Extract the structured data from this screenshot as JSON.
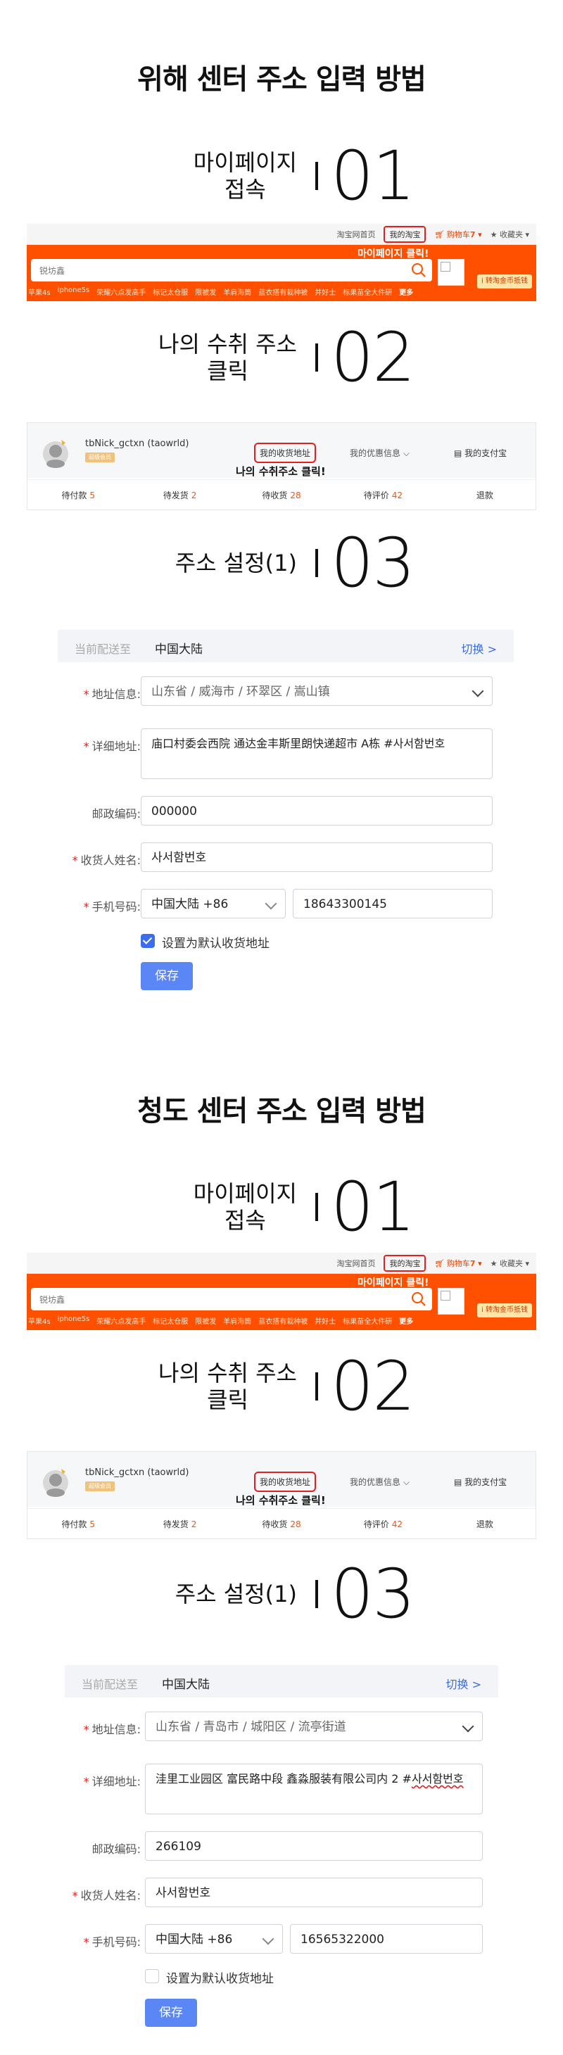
{
  "sections": [
    {
      "title": "위해 센터 주소 입력 방법",
      "steps": [
        {
          "label_lines": [
            "마이페이지",
            "접속"
          ],
          "number": "01"
        },
        {
          "label_lines": [
            "나의 수취 주소",
            "클릭"
          ],
          "number": "02"
        },
        {
          "label_lines": [
            "주소 설정(1)"
          ],
          "number": "03"
        }
      ],
      "taobao_header": {
        "top_links": [
          "淘宝网首页",
          "我的淘宝",
          "购物车",
          "7",
          "收藏夹"
        ],
        "annotation": "마이페이지 클릭!",
        "search_placeholder": "锐坊鑫",
        "badge": "i 转淘金币抵钱",
        "categories": [
          "苹果4s",
          "iphone5s",
          "荣耀六点发高手",
          "标记太仓服",
          "限被发",
          "羊肩海筒",
          "蓝衣搭有栽种被",
          "并好士",
          "标果苗全大件研",
          "更多"
        ]
      },
      "my_taobao": {
        "username": "tbNick_gctxn (taowrld)",
        "tag": "超级会员",
        "address_link": "我的收货地址",
        "annotation": "나의 수취주소 클릭!",
        "coupon": "我的优惠信息",
        "pay": "我的支付宝",
        "tabs": [
          {
            "label": "待付款",
            "count": "5"
          },
          {
            "label": "待发货",
            "count": "2"
          },
          {
            "label": "待收货",
            "count": "28"
          },
          {
            "label": "待评价",
            "count": "42"
          },
          {
            "label": "退款",
            "count": ""
          }
        ]
      },
      "form": {
        "deliver_label": "当前配送至",
        "deliver_value": "中国大陆",
        "switch": "切换 >",
        "address_label": "地址信息:",
        "address_value": "山东省 / 威海市 / 环翠区 / 嵩山镇",
        "detail_label": "详细地址:",
        "detail_value": "庙口村委会西院 通达金丰斯里朗快递超市 A栋 #사서함번호",
        "zip_label": "邮政编码:",
        "zip_value": "000000",
        "name_label": "收货人姓名:",
        "name_value": "사서함번호",
        "phone_label": "手机号码:",
        "phone_region": "中国大陆 +86",
        "phone_value": "18643300145",
        "default_label": "设置为默认收货地址",
        "default_checked": true,
        "save": "保存"
      }
    },
    {
      "title": "청도 센터 주소 입력 방법",
      "steps": [
        {
          "label_lines": [
            "마이페이지",
            "접속"
          ],
          "number": "01"
        },
        {
          "label_lines": [
            "나의 수취 주소",
            "클릭"
          ],
          "number": "02"
        },
        {
          "label_lines": [
            "주소 설정(1)"
          ],
          "number": "03"
        }
      ],
      "taobao_header": {
        "top_links": [
          "淘宝网首页",
          "我的淘宝",
          "购物车",
          "7",
          "收藏夹"
        ],
        "annotation": "마이페이지 클릭!",
        "search_placeholder": "锐坊鑫",
        "badge": "i 转淘金币抵钱",
        "categories": [
          "苹果4s",
          "iphone5s",
          "荣耀六点发高手",
          "标记太仓服",
          "限被发",
          "羊肩海筒",
          "蓝衣搭有栽种被",
          "并好士",
          "标果苗全大件研",
          "更多"
        ]
      },
      "my_taobao": {
        "username": "tbNick_gctxn (taowrld)",
        "tag": "超级会员",
        "address_link": "我的收货地址",
        "annotation": "나의 수취주소 클릭!",
        "coupon": "我的优惠信息",
        "pay": "我的支付宝",
        "tabs": [
          {
            "label": "待付款",
            "count": "5"
          },
          {
            "label": "待发货",
            "count": "2"
          },
          {
            "label": "待收货",
            "count": "28"
          },
          {
            "label": "待评价",
            "count": "42"
          },
          {
            "label": "退款",
            "count": ""
          }
        ]
      },
      "form": {
        "deliver_label": "当前配送至",
        "deliver_value": "中国大陆",
        "switch": "切换 >",
        "address_label": "地址信息:",
        "address_value": "山东省 / 青岛市 / 城阳区 / 流亭街道",
        "detail_label": "详细地址:",
        "detail_value_plain": "洼里工业园区 富民路中段 鑫淼服装有限公司内 2 #",
        "detail_value_marked": "사서함번호",
        "zip_label": "邮政编码:",
        "zip_value": "266109",
        "name_label": "收货人姓名:",
        "name_value": "사서함번호",
        "phone_label": "手机号码:",
        "phone_region": "中国大陆 +86",
        "phone_value": "16565322000",
        "default_label": "设置为默认收货地址",
        "default_checked": false,
        "save": "保存"
      }
    }
  ]
}
